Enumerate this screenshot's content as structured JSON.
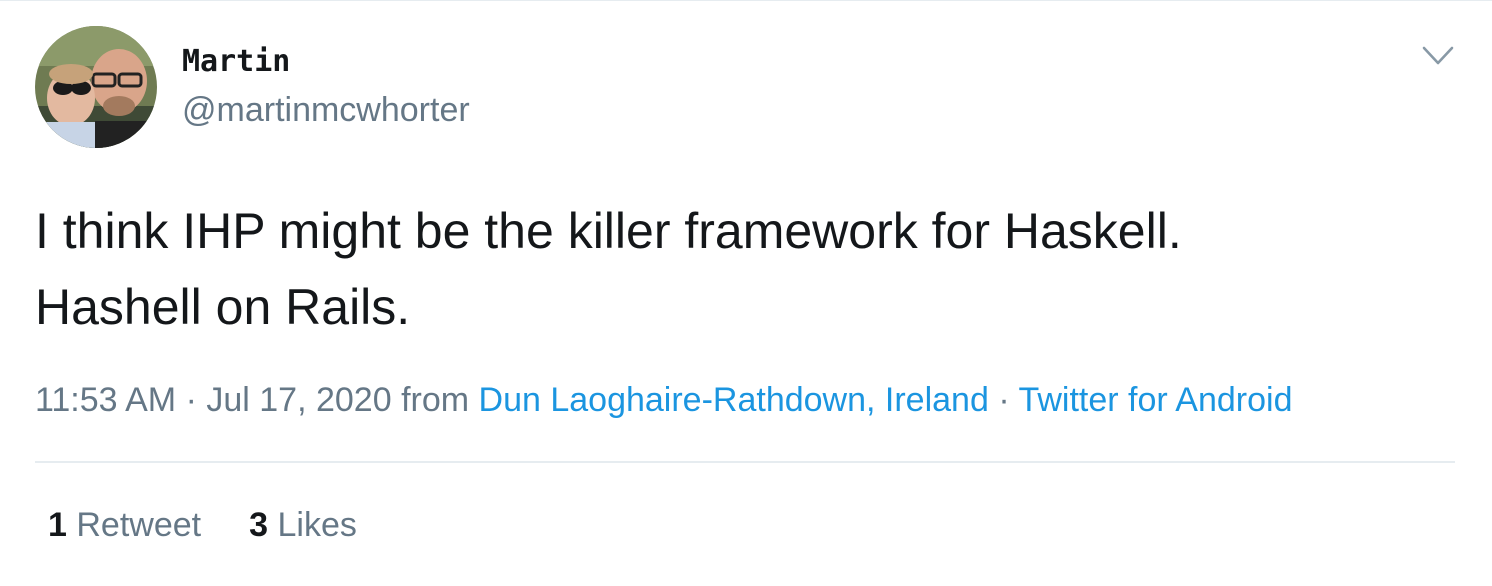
{
  "author": {
    "display_name": "Martin",
    "handle": "@martinmcwhorter"
  },
  "icons": {
    "avatar": "profile-photo",
    "menu": "chevron-down-icon"
  },
  "tweet": {
    "lines": [
      "I think IHP might be the killer framework for Haskell.",
      "Hashell on Rails."
    ]
  },
  "meta": {
    "time": "11:53 AM",
    "separator": " · ",
    "date": "Jul 17, 2020",
    "from_label": " from ",
    "location": "Dun Laoghaire-Rathdown, Ireland",
    "source": "Twitter for Android"
  },
  "stats": {
    "retweets_count": "1",
    "retweets_label": "Retweet",
    "likes_count": "3",
    "likes_label": "Likes"
  },
  "colors": {
    "text": "#14171a",
    "secondary": "#657786",
    "link": "#1b95e0",
    "border": "#e6ecf0"
  }
}
